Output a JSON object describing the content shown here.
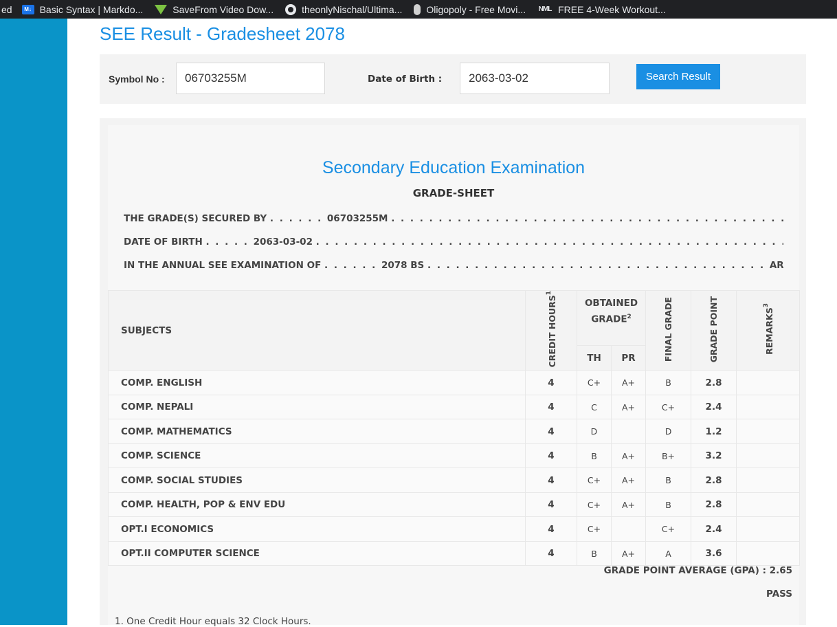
{
  "bookmarks": [
    {
      "label": "ed",
      "icon": "none"
    },
    {
      "label": "Basic Syntax | Markdo...",
      "icon": "markdown-icon"
    },
    {
      "label": "SaveFrom Video Dow...",
      "icon": "download-arrow-icon"
    },
    {
      "label": "theonlyNischal/Ultima...",
      "icon": "github-icon"
    },
    {
      "label": "Oligopoly - Free Movi...",
      "icon": "oligopoly-icon"
    },
    {
      "label": "FREE 4-Week Workout...",
      "icon": "nml-icon"
    }
  ],
  "page_title": "SEE Result - Gradesheet 2078",
  "search": {
    "symbol_label": "Symbol No :",
    "symbol_value": "06703255M",
    "dob_label": "Date of Birth :",
    "dob_value": "2063-03-02",
    "button_label": "Search Result"
  },
  "result": {
    "exam_title": "Secondary Education Examination",
    "sheet_title": "GRADE-SHEET",
    "secured_by_label": "THE GRADE(S) SECURED BY",
    "symbol_no": "06703255M",
    "dob_label": "DATE OF BIRTH",
    "dob": "2063-03-02",
    "exam_label": "IN THE ANNUAL SEE EXAMINATION OF",
    "year": "2078 BS",
    "given_below": "ARE GIVEN BELOW . . ."
  },
  "table": {
    "headers": {
      "subjects": "SUBJECTS",
      "credit_hours": "CREDIT HOURS",
      "credit_sup": "1",
      "obtained_grade": "OBTAINED GRADE",
      "obtained_sup": "2",
      "th": "TH",
      "pr": "PR",
      "final_grade": "FINAL GRADE",
      "grade_point": "GRADE POINT",
      "remarks": "REMARKS",
      "remarks_sup": "3"
    },
    "rows": [
      {
        "subject": "COMP. ENGLISH",
        "credit": "4",
        "th": "C+",
        "pr": "A+",
        "final": "B",
        "gp": "2.8",
        "remarks": ""
      },
      {
        "subject": "COMP. NEPALI",
        "credit": "4",
        "th": "C",
        "pr": "A+",
        "final": "C+",
        "gp": "2.4",
        "remarks": ""
      },
      {
        "subject": "COMP. MATHEMATICS",
        "credit": "4",
        "th": "D",
        "pr": "",
        "final": "D",
        "gp": "1.2",
        "remarks": ""
      },
      {
        "subject": "COMP. SCIENCE",
        "credit": "4",
        "th": "B",
        "pr": "A+",
        "final": "B+",
        "gp": "3.2",
        "remarks": ""
      },
      {
        "subject": "COMP. SOCIAL STUDIES",
        "credit": "4",
        "th": "C+",
        "pr": "A+",
        "final": "B",
        "gp": "2.8",
        "remarks": ""
      },
      {
        "subject": "COMP. HEALTH, POP & ENV EDU",
        "credit": "4",
        "th": "C+",
        "pr": "A+",
        "final": "B",
        "gp": "2.8",
        "remarks": ""
      },
      {
        "subject": "OPT.I ECONOMICS",
        "credit": "4",
        "th": "C+",
        "pr": "",
        "final": "C+",
        "gp": "2.4",
        "remarks": ""
      },
      {
        "subject": "OPT.II COMPUTER SCIENCE",
        "credit": "4",
        "th": "B",
        "pr": "A+",
        "final": "A",
        "gp": "3.6",
        "remarks": ""
      }
    ]
  },
  "gpa_label": "GRADE POINT AVERAGE (GPA) :",
  "gpa_value": "2.65",
  "status": "PASS",
  "footnote": "1. One Credit Hour equals 32 Clock Hours.",
  "colors": {
    "accent": "#1a8fe3",
    "sidebar": "#0a94c8",
    "bookmarks_bar": "#202124"
  }
}
